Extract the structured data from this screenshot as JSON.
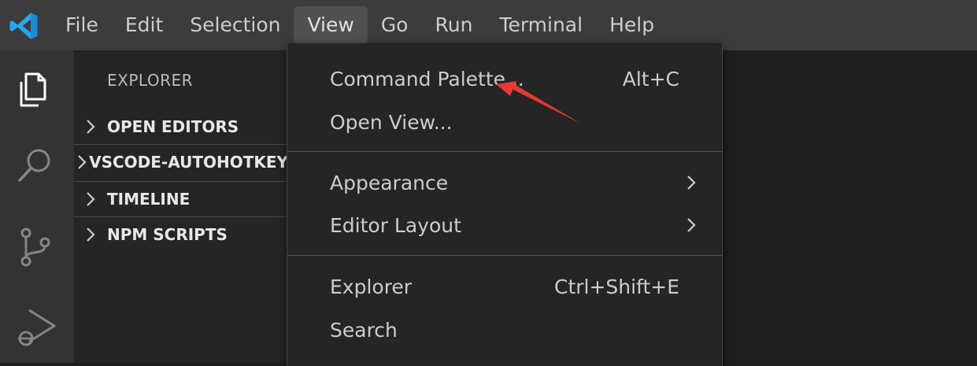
{
  "menubar": {
    "items": [
      "File",
      "Edit",
      "Selection",
      "View",
      "Go",
      "Run",
      "Terminal",
      "Help"
    ],
    "active": "View"
  },
  "sidebar": {
    "title": "EXPLORER",
    "sections": [
      "OPEN EDITORS",
      "VSCODE-AUTOHOTKEY",
      "TIMELINE",
      "NPM SCRIPTS"
    ]
  },
  "view_menu": {
    "command_palette": {
      "label": "Command Palette...",
      "shortcut": "Alt+C"
    },
    "open_view": {
      "label": "Open View..."
    },
    "appearance": {
      "label": "Appearance"
    },
    "editor_layout": {
      "label": "Editor Layout"
    },
    "explorer": {
      "label": "Explorer",
      "shortcut": "Ctrl+Shift+E"
    },
    "search": {
      "label": "Search"
    }
  },
  "colors": {
    "accent": "#007acc",
    "annotation_arrow": "#e53935",
    "menubar_bg": "#3c3c3c",
    "menu_bg": "#252526"
  },
  "icons": [
    "vscode-logo-icon",
    "files-icon",
    "search-icon",
    "source-control-icon",
    "run-debug-icon",
    "chevron-right-icon"
  ]
}
